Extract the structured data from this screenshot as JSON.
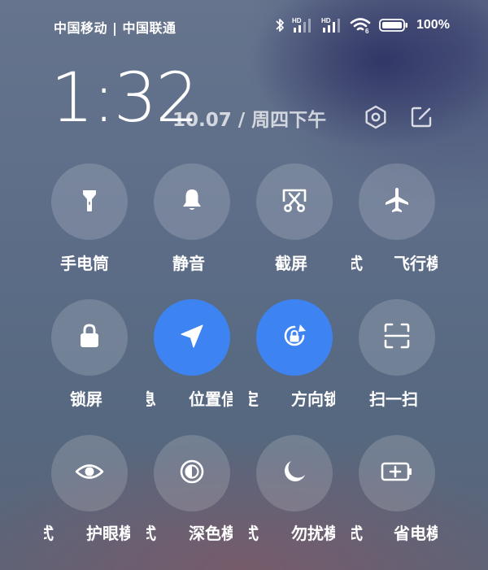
{
  "status_bar": {
    "carrier": "中国移动 | 中国联通",
    "signal_1_tag": "HD",
    "signal_2_tag": "HD",
    "wifi_tag": "6",
    "battery": "100%"
  },
  "header": {
    "time": "1:32",
    "date": "10.07 / 周四下午"
  },
  "tiles": [
    {
      "label": "手电筒",
      "prefix": "",
      "icon": "flashlight-icon",
      "active": false
    },
    {
      "label": "静音",
      "prefix": "",
      "icon": "bell-icon",
      "active": false
    },
    {
      "label": "截屏",
      "prefix": "",
      "icon": "screenshot-icon",
      "active": false
    },
    {
      "label": "飞行模",
      "prefix": "式",
      "icon": "airplane-icon",
      "active": false
    },
    {
      "label": "锁屏",
      "prefix": "",
      "icon": "lock-icon",
      "active": false
    },
    {
      "label": "位置信",
      "prefix": "息",
      "icon": "location-arrow-icon",
      "active": true
    },
    {
      "label": "方向锁",
      "prefix": "定",
      "icon": "rotation-lock-icon",
      "active": true
    },
    {
      "label": "扫一扫",
      "prefix": "",
      "icon": "scan-icon",
      "active": false
    },
    {
      "label": "护眼模",
      "prefix": "式",
      "icon": "eye-icon",
      "active": false
    },
    {
      "label": "深色模",
      "prefix": "式",
      "icon": "contrast-icon",
      "active": false
    },
    {
      "label": "勿扰模",
      "prefix": "式",
      "icon": "moon-icon",
      "active": false
    },
    {
      "label": "省电模",
      "prefix": "式",
      "icon": "battery-saver-icon",
      "active": false
    }
  ],
  "colors": {
    "active": "#3d83f2",
    "inactive": "rgba(255,255,255,0.16)"
  }
}
